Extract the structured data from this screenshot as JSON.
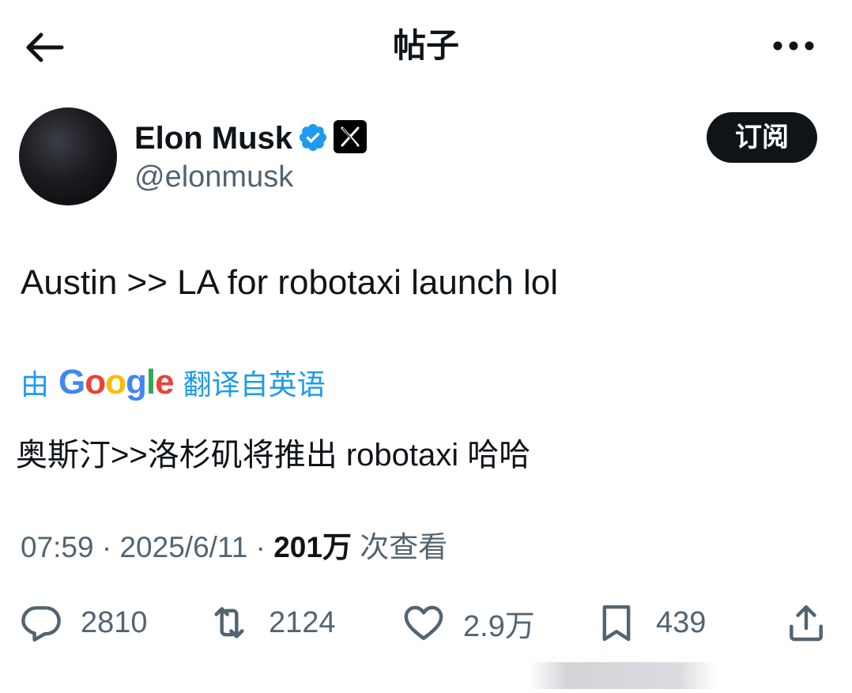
{
  "header": {
    "title": "帖子",
    "back_icon": "arrow-left-icon",
    "more_icon": "more-horizontal-icon"
  },
  "author": {
    "name": "Elon Musk",
    "handle": "@elonmusk",
    "verified_icon": "verified-badge-icon",
    "affiliate_icon": "x-logo-icon",
    "subscribe_label": "订阅",
    "verified_color": "#1d9bf0"
  },
  "post": {
    "text": "Austin >> LA for robotaxi launch lol",
    "translation_prefix": "由",
    "translation_service": "Google",
    "translation_suffix": "翻译自英语",
    "translated_text": "奥斯汀>>洛杉矶将推出 robotaxi 哈哈"
  },
  "meta": {
    "time": "07:59",
    "separator": "·",
    "date": "2025/6/11",
    "views_count": "201万",
    "views_label": "次查看"
  },
  "actions": {
    "reply": "2810",
    "repost": "2124",
    "like": "2.9万",
    "bookmark": "439",
    "share_icon": "share-icon"
  },
  "colors": {
    "accent": "#1d9bf0",
    "text": "#0f1419",
    "secondary": "#536471"
  }
}
